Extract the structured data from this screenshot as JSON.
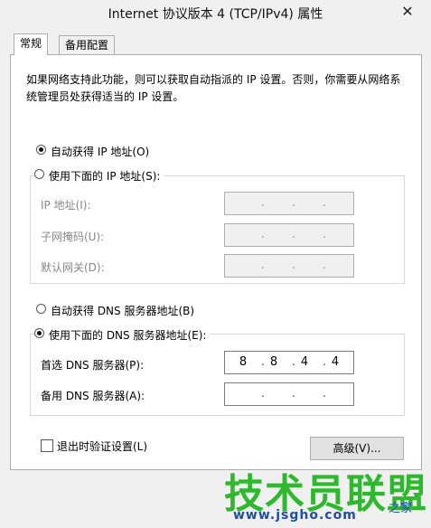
{
  "window": {
    "title": "Internet 协议版本 4 (TCP/IPv4) 属性"
  },
  "tabs": [
    {
      "label": "常规",
      "active": true
    },
    {
      "label": "备用配置",
      "active": false
    }
  ],
  "description": "如果网络支持此功能，则可以获取自动指派的 IP 设置。否则，你需要从网络系统管理员处获得适当的 IP 设置。",
  "ip_section": {
    "auto_label": "自动获得 IP 地址(O)",
    "manual_label": "使用下面的 IP 地址(S):",
    "auto_selected": true,
    "fields": [
      {
        "label": "IP 地址(I):",
        "octets": [
          "",
          "",
          "",
          ""
        ]
      },
      {
        "label": "子网掩码(U):",
        "octets": [
          "",
          "",
          "",
          ""
        ]
      },
      {
        "label": "默认网关(D):",
        "octets": [
          "",
          "",
          "",
          ""
        ]
      }
    ]
  },
  "dns_section": {
    "auto_label": "自动获得 DNS 服务器地址(B)",
    "manual_label": "使用下面的 DNS 服务器地址(E):",
    "manual_selected": true,
    "fields": [
      {
        "label": "首选 DNS 服务器(P):",
        "octets": [
          "8",
          "8",
          "4",
          "4"
        ]
      },
      {
        "label": "备用 DNS 服务器(A):",
        "octets": [
          "",
          "",
          "",
          ""
        ]
      }
    ]
  },
  "validate_on_exit": {
    "label": "退出时验证设置(L)",
    "checked": false
  },
  "advanced_button": "高级(V)...",
  "watermark": {
    "text": "技术员联盟",
    "url": "www.jsgho.com",
    "site": "之家"
  },
  "close_glyph": "✕"
}
